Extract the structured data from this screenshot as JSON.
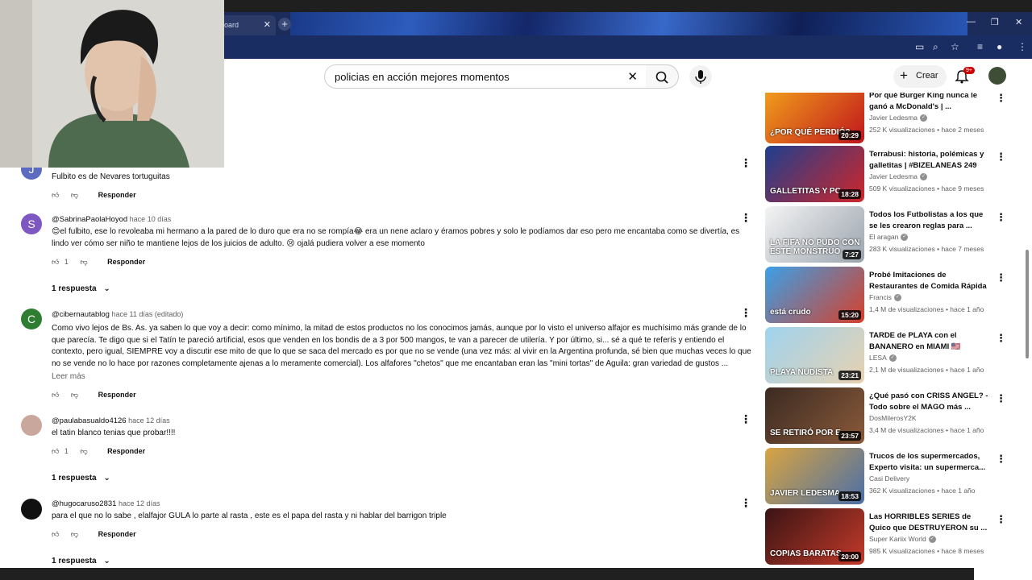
{
  "browser": {
    "tab_title": "oard",
    "tab_close": "✕",
    "new_tab": "+"
  },
  "youtube": {
    "search_value": "policias en acción mejores momentos",
    "create_label": "Crear",
    "notif_count": "9+"
  },
  "comments": [
    {
      "author": "",
      "time": "",
      "text": "Fulbito es de Nevares tortuguitas",
      "likes": "",
      "reply": "Responder",
      "color": "#5b6bc0",
      "initial": "J"
    },
    {
      "author": "@SabrinaPaolaHoyod",
      "time": "hace 10 días",
      "text": "😊el fulbito, ese lo revoleaba mi hermano a la pared de lo duro que era no se rompía😂 era un nene aclaro y éramos pobres y solo le podíamos dar eso pero me encantaba como se divertía, es lindo ver cómo ser niño te mantiene lejos de los juicios de adulto. 😢 ojalá pudiera volver a ese momento",
      "likes": "1",
      "reply": "Responder",
      "replies": "1 respuesta",
      "color": "#7e57c2",
      "initial": "S"
    },
    {
      "author": "@cibernautablog",
      "time": "hace 11 días (editado)",
      "text": "Como vivo lejos de Bs. As. ya saben lo que voy a decir: como mínimo, la mitad de estos productos no los conocimos jamás, aunque por lo visto el universo alfajor es muchísimo más grande de lo que parecía. Te digo que si el Tatín te pareció artificial, esos que venden en los bondis de a 3 por 500 mangos, te van a parecer de utilería. Y por último, si... sé a qué te referís y entiendo el contexto, pero igual, SIEMPRE voy a discutir ese mito de que lo que se saca del mercado es por que no se vende (una vez más: al vivir en la Argentina profunda, sé bien que muchas veces lo que no se vende no lo hace por razones completamente ajenas a lo meramente comercial). Los alfafores \"chetos\" que me encantaban eran las \"mini tortas\" de Aguila: gran variedad de gustos ...",
      "more": "Leer más",
      "likes": "",
      "reply": "Responder",
      "color": "#2e7d32",
      "initial": "C"
    },
    {
      "author": "@paulabasualdo4126",
      "time": "hace 12 días",
      "text": "el tatin blanco tenias que probar!!!!",
      "likes": "1",
      "reply": "Responder",
      "replies": "1 respuesta",
      "color": "#c9a79c",
      "initial": ""
    },
    {
      "author": "@hugocaruso2831",
      "time": "hace 12 días",
      "text": "para el que no lo sabe , elalfajor GULA  lo parte al rasta , este es el papa del rasta y ni hablar del barrigon triple",
      "likes": "",
      "reply": "Responder",
      "replies": "1 respuesta",
      "color": "#111111",
      "initial": ""
    }
  ],
  "videos": [
    {
      "title": "Por qué Burger King nunca le ganó a McDonald's | ...",
      "channel": "Javier Ledesma",
      "verified": true,
      "stats": "252 K visualizaciones • hace 2 meses",
      "duration": "20:29",
      "caption": "¿POR QUÉ PERDIÓ?",
      "c1": "#f2a11b",
      "c2": "#c0151b"
    },
    {
      "title": "Terrabusi: historia, polémicas y galletitas | #BIZELANEAS 249",
      "channel": "Javier Ledesma",
      "verified": true,
      "stats": "509 K visualizaciones • hace 9 meses",
      "duration": "18:28",
      "caption": "GALLETITAS Y PC",
      "c1": "#1d3f8f",
      "c2": "#d0262a"
    },
    {
      "title": "Todos los Futbolistas a los que se les crearon reglas para ...",
      "channel": "El aragan",
      "verified": true,
      "stats": "283 K visualizaciones • hace 7 meses",
      "duration": "7:27",
      "caption": "LA FIFA NO PUDO CON ESTE MONSTRUO",
      "c1": "#f4f4f4",
      "c2": "#9aa3ad"
    },
    {
      "title": "Probé Imitaciones de Restaurantes de Comida Rápida",
      "channel": "Francis",
      "verified": true,
      "stats": "1,4 M de visualizaciones • hace 1 año",
      "duration": "15:20",
      "caption": "está crudo",
      "c1": "#3aa0e8",
      "c2": "#d6402a"
    },
    {
      "title": "TARDE de PLAYA con el BANANERO en MIAMI 🇺🇸",
      "channel": "LESA",
      "verified": true,
      "stats": "2,1 M de visualizaciones • hace 1 año",
      "duration": "23:21",
      "caption": "PLAYA NUDISTA",
      "c1": "#9fd3ef",
      "c2": "#e7d1b0"
    },
    {
      "title": "¿Qué pasó con CRISS ANGEL? - Todo sobre el MAGO más ...",
      "channel": "DosMilerosY2K",
      "verified": false,
      "stats": "3,4 M de visualizaciones • hace 1 año",
      "duration": "23:57",
      "caption": "SE RETIRÓ POR E",
      "c1": "#3b2a22",
      "c2": "#8a5a3a"
    },
    {
      "title": "Trucos de los supermercados, Experto visita: un supermerca...",
      "channel": "Casi Delivery",
      "verified": false,
      "stats": "362 K visualizaciones • hace 1 año",
      "duration": "18:53",
      "caption": "JAVIER LEDESMA",
      "c1": "#d9a441",
      "c2": "#4a6fa8"
    },
    {
      "title": "Las HORRIBLES SERIES de Quico que DESTRUYERON su ...",
      "channel": "Super Kariix World",
      "verified": true,
      "stats": "985 K visualizaciones • hace 8 meses",
      "duration": "20:00",
      "caption": "COPIAS BARATAS",
      "c1": "#3a1414",
      "c2": "#c43a2a"
    }
  ]
}
